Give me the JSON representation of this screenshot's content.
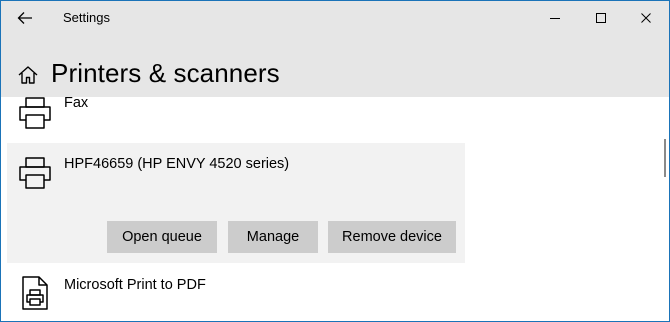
{
  "window": {
    "title": "Settings"
  },
  "page": {
    "title": "Printers & scanners"
  },
  "icons": {
    "back": "back-arrow-icon",
    "minimize": "minimize-icon",
    "maximize": "maximize-icon",
    "close": "close-icon",
    "home": "home-icon",
    "printer": "printer-icon",
    "pdf_printer": "pdf-printer-icon"
  },
  "devices": [
    {
      "name": "Fax"
    },
    {
      "name": "HPF46659 (HP ENVY 4520 series)",
      "actions": {
        "open_queue": "Open queue",
        "manage": "Manage",
        "remove_device": "Remove device"
      }
    },
    {
      "name": "Microsoft Print to PDF"
    }
  ],
  "colors": {
    "header_bg": "#e6e6e6",
    "selected_row_bg": "#f2f2f2",
    "button_bg": "#cccccc",
    "window_border": "#1a73b8"
  }
}
